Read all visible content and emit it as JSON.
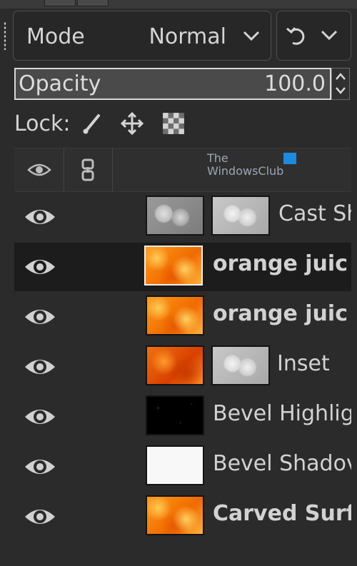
{
  "mode": {
    "label": "Mode",
    "value": "Normal"
  },
  "opacity": {
    "label": "Opacity",
    "value": "100.0"
  },
  "lock": {
    "label": "Lock:"
  },
  "watermark": {
    "line1": "The",
    "line2": "WindowsClub"
  },
  "layers": [
    {
      "name": "Cast Sh",
      "bold": false,
      "selected": false
    },
    {
      "name": "orange juic",
      "bold": true,
      "selected": true
    },
    {
      "name": "orange juic",
      "bold": true,
      "selected": false
    },
    {
      "name": "Inset",
      "bold": false,
      "selected": false
    },
    {
      "name": "Bevel Highligl",
      "bold": false,
      "selected": false
    },
    {
      "name": "Bevel Shadov",
      "bold": false,
      "selected": false
    },
    {
      "name": "Carved Surf",
      "bold": true,
      "selected": false
    }
  ],
  "icons": {
    "visibility": "eye-icon",
    "chain": "link-icon",
    "lock_paint": "paintbrush-icon",
    "lock_position": "move-icon",
    "lock_alpha": "checkerboard-icon",
    "undo": "reset-icon",
    "dropdown": "chevron-down-icon"
  },
  "colors": {
    "panel": "#2b2b2b",
    "selected_row": "#1c1c1c",
    "text": "#d2d2d2"
  }
}
